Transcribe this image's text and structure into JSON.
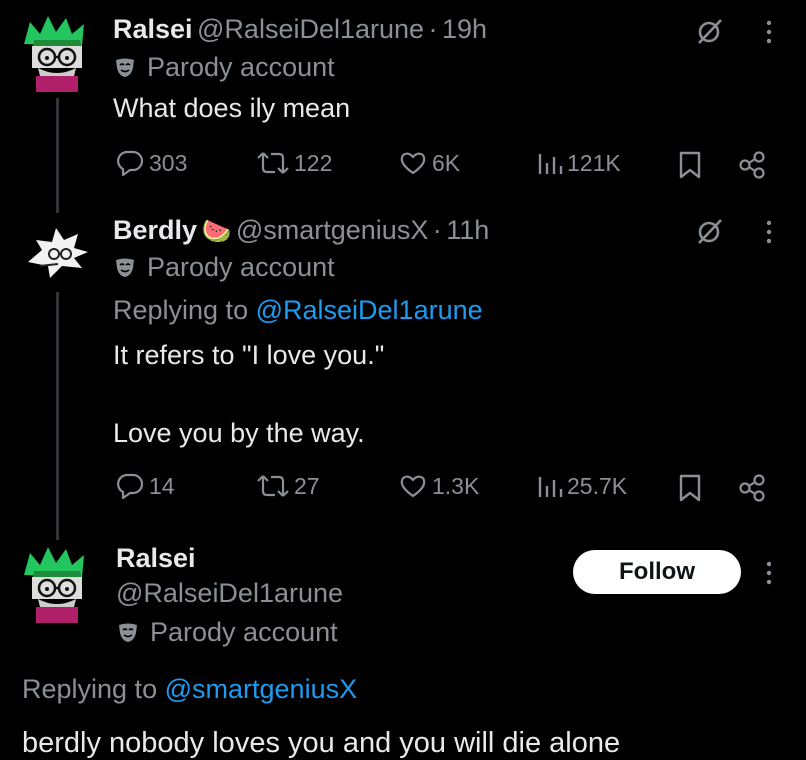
{
  "tweets": [
    {
      "name": "Ralsei",
      "handle": "@RalseiDel1arune",
      "time": "19h",
      "parody_label": "Parody account",
      "text_lines": [
        "What does ily mean"
      ],
      "stats": {
        "replies": "303",
        "reposts": "122",
        "likes": "6K",
        "views": "121K"
      }
    },
    {
      "name": "Berdly",
      "emoji": "🍉",
      "handle": "@smartgeniusX",
      "time": "11h",
      "parody_label": "Parody account",
      "replying_prefix": "Replying to",
      "replying_to": "@RalseiDel1arune",
      "text_lines": [
        "It refers to \"I love you.\"",
        "Love you by the way."
      ],
      "stats": {
        "replies": "14",
        "reposts": "27",
        "likes": "1.3K",
        "views": "25.7K"
      }
    },
    {
      "name": "Ralsei",
      "handle": "@RalseiDel1arune",
      "parody_label": "Parody account",
      "follow_label": "Follow",
      "replying_prefix": "Replying to",
      "replying_to": "@smartgeniusX",
      "text_lines": [
        "berdly nobody loves you and you will die alone"
      ]
    }
  ],
  "separator": "·",
  "icons": [
    "ralsei-avatar",
    "berdly-avatar",
    "grok-icon",
    "more-icon",
    "reply-icon",
    "repost-icon",
    "like-icon",
    "views-icon",
    "bookmark-icon",
    "share-icon",
    "parody-mask-icon"
  ],
  "colors": {
    "background": "#000000",
    "text": "#e7e9ea",
    "secondary": "#8b9096",
    "link": "#1d9bf0"
  }
}
